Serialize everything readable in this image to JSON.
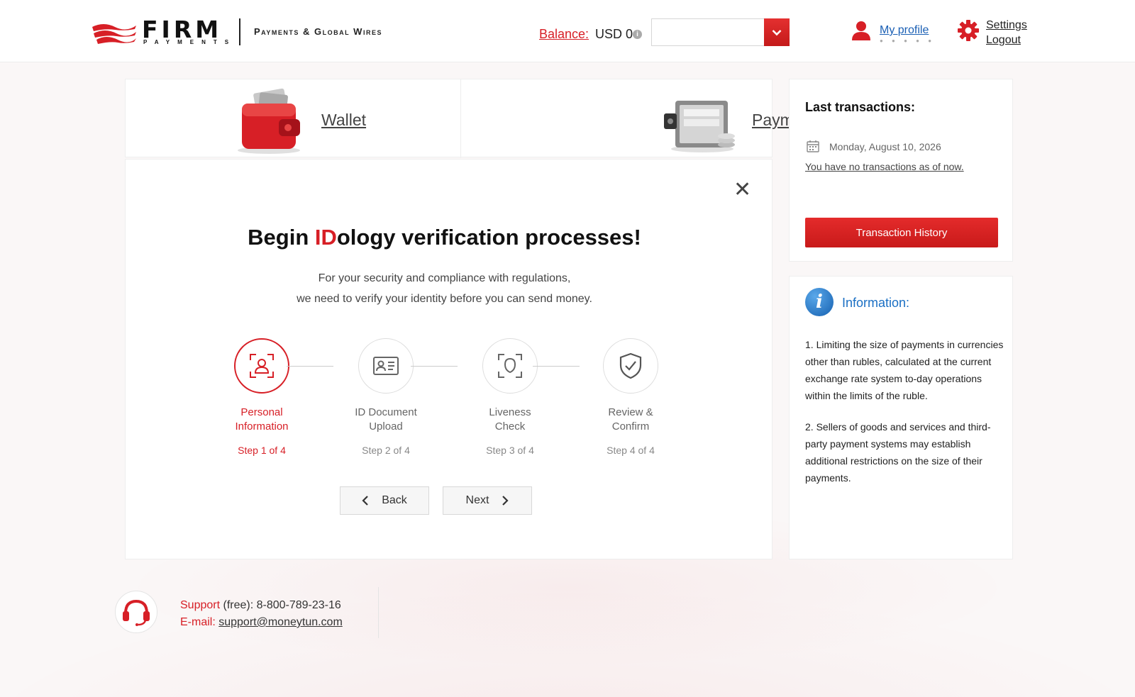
{
  "header": {
    "logo_word": "FIRM",
    "logo_sub": "PAYMENTS",
    "tagline": "Payments & Global Wires",
    "balance_label": "Balance:",
    "balance_value": "USD 0",
    "currency_select_value": "",
    "profile_label": "My profile",
    "profile_stars": "● ● ● ● ●",
    "settings_label": "Settings",
    "logout_label": "Logout"
  },
  "tabs": {
    "wallet": "Wallet",
    "payment": "Payment"
  },
  "verification": {
    "close": "✕",
    "title_prefix": "Begin ",
    "title_highlight": "ID",
    "title_suffix": "ology verification processes!",
    "subtitle_line1": "For your security and compliance with regulations,",
    "subtitle_line2": "we need to verify your identity before you can send money.",
    "steps": [
      {
        "title_line1": "Personal",
        "title_line2": "Information",
        "count": "Step 1 of 4",
        "icon": "personal-info-icon"
      },
      {
        "title_line1": "ID Document",
        "title_line2": "Upload",
        "count": "Step 2 of 4",
        "icon": "id-card-icon"
      },
      {
        "title_line1": "Liveness",
        "title_line2": "Check",
        "count": "Step 3 of 4",
        "icon": "face-scan-icon"
      },
      {
        "title_line1": "Review &",
        "title_line2": "Confirm",
        "count": "Step 4 of 4",
        "icon": "shield-check-icon"
      }
    ],
    "active_step": 1,
    "back_label": "Back",
    "next_label": "Next"
  },
  "last_transactions": {
    "title": "Last transactions:",
    "date": "Monday, August 10, 2026",
    "empty_text": "You have no transactions as of now.",
    "history_button": "Transaction History"
  },
  "information": {
    "title": "Information:",
    "para1": "1. Limiting the size of payments in currencies other than rubles, calculated at the current exchange rate system to-day operations within the limits of the ruble.",
    "para2": "2. Sellers of goods and services and third-party payment systems may establish additional restrictions on the size of their payments."
  },
  "footer": {
    "support_label": "Support",
    "support_text": " (free): 8-800-789-23-16",
    "email_label": "E-mail:",
    "email_value": "support@moneytun.com"
  },
  "colors": {
    "accent": "#d71f26",
    "info_blue": "#1a6fc4",
    "link_blue": "#1a5fb4"
  }
}
